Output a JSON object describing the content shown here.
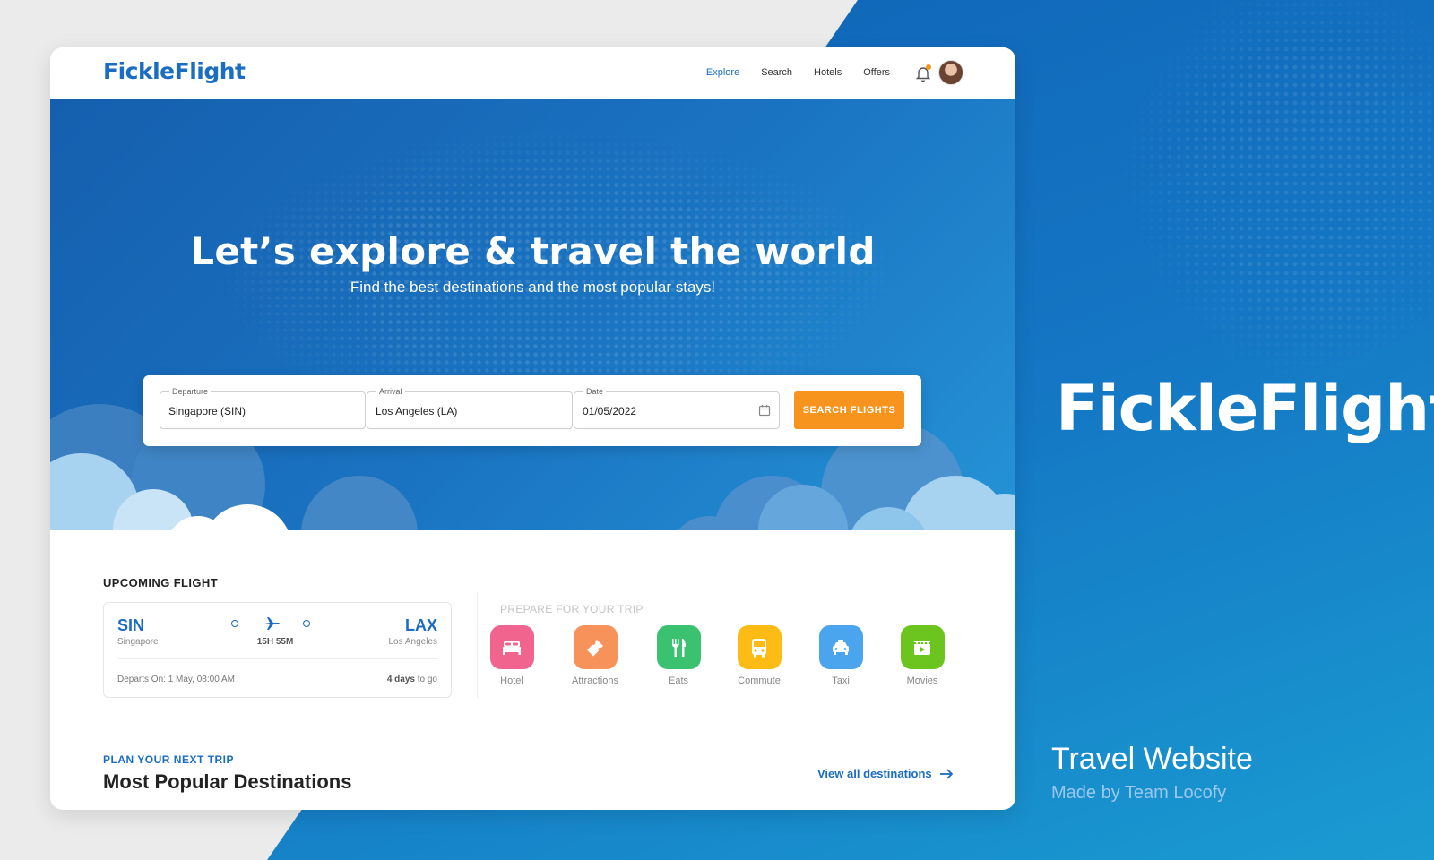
{
  "brand": {
    "name": "FickleFlight"
  },
  "nav": {
    "links": [
      "Explore",
      "Search",
      "Hotels",
      "Offers"
    ],
    "active": "Explore"
  },
  "hero": {
    "title": "Let’s explore & travel the world",
    "subtitle": "Find the best destinations and the most popular stays!"
  },
  "search": {
    "departure_label": "Departure",
    "departure_value": "Singapore (SIN)",
    "arrival_label": "Arrival",
    "arrival_value": "Los Angeles (LA)",
    "date_label": "Date",
    "date_value": "01/05/2022",
    "button_label": "SEARCH FLIGHTS"
  },
  "upcoming": {
    "title": "UPCOMING FLIGHT",
    "from_code": "SIN",
    "from_city": "Singapore",
    "to_code": "LAX",
    "to_city": "Los Angeles",
    "duration": "15H 55M",
    "departs": "Departs On: 1 May, 08:00 AM",
    "days_count": "4 days",
    "days_suffix": " to go"
  },
  "prepare": {
    "title": "PREPARE FOR YOUR TRIP",
    "items": [
      {
        "label": "Hotel",
        "icon": "bed-icon",
        "color": "#f0648d"
      },
      {
        "label": "Attractions",
        "icon": "ticket-icon",
        "color": "#f7925a"
      },
      {
        "label": "Eats",
        "icon": "utensils-icon",
        "color": "#3ac270"
      },
      {
        "label": "Commute",
        "icon": "bus-icon",
        "color": "#fdbb16"
      },
      {
        "label": "Taxi",
        "icon": "taxi-icon",
        "color": "#4aa4ee"
      },
      {
        "label": "Movies",
        "icon": "movie-icon",
        "color": "#6cc51e"
      }
    ]
  },
  "plan": {
    "eyebrow": "PLAN YOUR NEXT TRIP",
    "title": "Most Popular Destinations",
    "view_all": "View all destinations"
  },
  "side": {
    "logo": "FickleFlight",
    "title": "Travel Website",
    "subtitle": "Made by Team Locofy"
  },
  "colors": {
    "brand_blue": "#1a6dc1",
    "accent_orange": "#f7941d"
  }
}
